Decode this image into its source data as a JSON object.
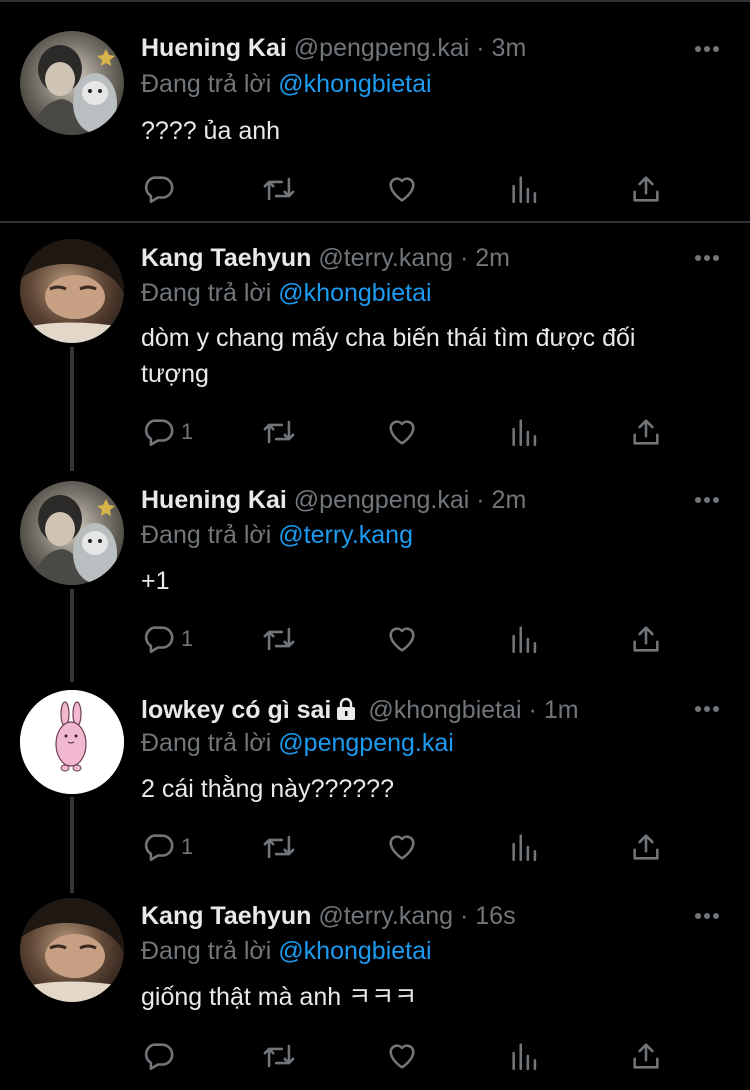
{
  "tweets": [
    {
      "name": "Huening Kai",
      "handle": "@pengpeng.kai",
      "dot": "·",
      "time": "3m",
      "reply_prefix": "Đang trả lời",
      "reply_to": "@khongbietai",
      "text": "???? ủa anh",
      "reply_count": "",
      "avatar": "huening-kai"
    },
    {
      "name": "Kang Taehyun",
      "handle": "@terry.kang",
      "dot": "·",
      "time": "2m",
      "reply_prefix": "Đang trả lời",
      "reply_to": "@khongbietai",
      "text": "dòm y chang mấy cha biến thái tìm được đối tượng",
      "reply_count": "1",
      "avatar": "kang-taehyun"
    },
    {
      "name": "Huening Kai",
      "handle": "@pengpeng.kai",
      "dot": "·",
      "time": "2m",
      "reply_prefix": "Đang trả lời",
      "reply_to": "@terry.kang",
      "text": "+1",
      "reply_count": "1",
      "avatar": "huening-kai"
    },
    {
      "name": "lowkey có gì sai",
      "handle": "@khongbietai",
      "dot": "·",
      "time": "1m",
      "reply_prefix": "Đang trả lời",
      "reply_to": "@pengpeng.kai",
      "text": "2 cái thằng này??????",
      "reply_count": "1",
      "avatar": "pink-bunny",
      "locked": true
    },
    {
      "name": "Kang Taehyun",
      "handle": "@terry.kang",
      "dot": "·",
      "time": "16s",
      "reply_prefix": "Đang trả lời",
      "reply_to": "@khongbietai",
      "text": "giống thật mà anh ㅋㅋㅋ",
      "reply_count": "",
      "avatar": "kang-taehyun"
    }
  ],
  "icons": {
    "reply": "reply-bubble-icon",
    "retweet": "retweet-icon",
    "like": "heart-icon",
    "views": "bar-chart-icon",
    "share": "share-upload-icon",
    "more": "more-dots-icon",
    "lock": "lock-icon"
  },
  "colors": {
    "background": "#000000",
    "text": "#e7e9ea",
    "secondary": "#71767b",
    "link": "#1d9bf0",
    "divider": "#2f3336"
  }
}
